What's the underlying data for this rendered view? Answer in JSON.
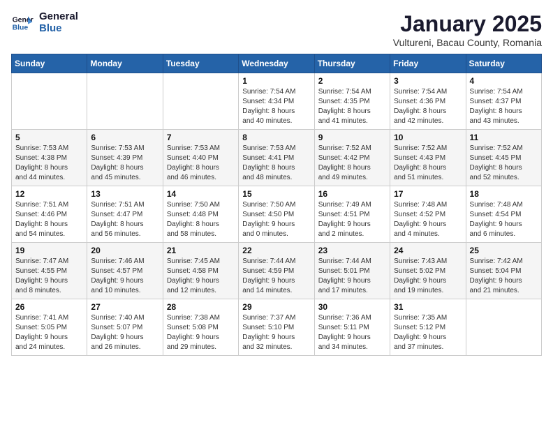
{
  "logo": {
    "line1": "General",
    "line2": "Blue"
  },
  "title": "January 2025",
  "subtitle": "Vultureni, Bacau County, Romania",
  "headers": [
    "Sunday",
    "Monday",
    "Tuesday",
    "Wednesday",
    "Thursday",
    "Friday",
    "Saturday"
  ],
  "weeks": [
    [
      {
        "day": "",
        "info": ""
      },
      {
        "day": "",
        "info": ""
      },
      {
        "day": "",
        "info": ""
      },
      {
        "day": "1",
        "info": "Sunrise: 7:54 AM\nSunset: 4:34 PM\nDaylight: 8 hours\nand 40 minutes."
      },
      {
        "day": "2",
        "info": "Sunrise: 7:54 AM\nSunset: 4:35 PM\nDaylight: 8 hours\nand 41 minutes."
      },
      {
        "day": "3",
        "info": "Sunrise: 7:54 AM\nSunset: 4:36 PM\nDaylight: 8 hours\nand 42 minutes."
      },
      {
        "day": "4",
        "info": "Sunrise: 7:54 AM\nSunset: 4:37 PM\nDaylight: 8 hours\nand 43 minutes."
      }
    ],
    [
      {
        "day": "5",
        "info": "Sunrise: 7:53 AM\nSunset: 4:38 PM\nDaylight: 8 hours\nand 44 minutes."
      },
      {
        "day": "6",
        "info": "Sunrise: 7:53 AM\nSunset: 4:39 PM\nDaylight: 8 hours\nand 45 minutes."
      },
      {
        "day": "7",
        "info": "Sunrise: 7:53 AM\nSunset: 4:40 PM\nDaylight: 8 hours\nand 46 minutes."
      },
      {
        "day": "8",
        "info": "Sunrise: 7:53 AM\nSunset: 4:41 PM\nDaylight: 8 hours\nand 48 minutes."
      },
      {
        "day": "9",
        "info": "Sunrise: 7:52 AM\nSunset: 4:42 PM\nDaylight: 8 hours\nand 49 minutes."
      },
      {
        "day": "10",
        "info": "Sunrise: 7:52 AM\nSunset: 4:43 PM\nDaylight: 8 hours\nand 51 minutes."
      },
      {
        "day": "11",
        "info": "Sunrise: 7:52 AM\nSunset: 4:45 PM\nDaylight: 8 hours\nand 52 minutes."
      }
    ],
    [
      {
        "day": "12",
        "info": "Sunrise: 7:51 AM\nSunset: 4:46 PM\nDaylight: 8 hours\nand 54 minutes."
      },
      {
        "day": "13",
        "info": "Sunrise: 7:51 AM\nSunset: 4:47 PM\nDaylight: 8 hours\nand 56 minutes."
      },
      {
        "day": "14",
        "info": "Sunrise: 7:50 AM\nSunset: 4:48 PM\nDaylight: 8 hours\nand 58 minutes."
      },
      {
        "day": "15",
        "info": "Sunrise: 7:50 AM\nSunset: 4:50 PM\nDaylight: 9 hours\nand 0 minutes."
      },
      {
        "day": "16",
        "info": "Sunrise: 7:49 AM\nSunset: 4:51 PM\nDaylight: 9 hours\nand 2 minutes."
      },
      {
        "day": "17",
        "info": "Sunrise: 7:48 AM\nSunset: 4:52 PM\nDaylight: 9 hours\nand 4 minutes."
      },
      {
        "day": "18",
        "info": "Sunrise: 7:48 AM\nSunset: 4:54 PM\nDaylight: 9 hours\nand 6 minutes."
      }
    ],
    [
      {
        "day": "19",
        "info": "Sunrise: 7:47 AM\nSunset: 4:55 PM\nDaylight: 9 hours\nand 8 minutes."
      },
      {
        "day": "20",
        "info": "Sunrise: 7:46 AM\nSunset: 4:57 PM\nDaylight: 9 hours\nand 10 minutes."
      },
      {
        "day": "21",
        "info": "Sunrise: 7:45 AM\nSunset: 4:58 PM\nDaylight: 9 hours\nand 12 minutes."
      },
      {
        "day": "22",
        "info": "Sunrise: 7:44 AM\nSunset: 4:59 PM\nDaylight: 9 hours\nand 14 minutes."
      },
      {
        "day": "23",
        "info": "Sunrise: 7:44 AM\nSunset: 5:01 PM\nDaylight: 9 hours\nand 17 minutes."
      },
      {
        "day": "24",
        "info": "Sunrise: 7:43 AM\nSunset: 5:02 PM\nDaylight: 9 hours\nand 19 minutes."
      },
      {
        "day": "25",
        "info": "Sunrise: 7:42 AM\nSunset: 5:04 PM\nDaylight: 9 hours\nand 21 minutes."
      }
    ],
    [
      {
        "day": "26",
        "info": "Sunrise: 7:41 AM\nSunset: 5:05 PM\nDaylight: 9 hours\nand 24 minutes."
      },
      {
        "day": "27",
        "info": "Sunrise: 7:40 AM\nSunset: 5:07 PM\nDaylight: 9 hours\nand 26 minutes."
      },
      {
        "day": "28",
        "info": "Sunrise: 7:38 AM\nSunset: 5:08 PM\nDaylight: 9 hours\nand 29 minutes."
      },
      {
        "day": "29",
        "info": "Sunrise: 7:37 AM\nSunset: 5:10 PM\nDaylight: 9 hours\nand 32 minutes."
      },
      {
        "day": "30",
        "info": "Sunrise: 7:36 AM\nSunset: 5:11 PM\nDaylight: 9 hours\nand 34 minutes."
      },
      {
        "day": "31",
        "info": "Sunrise: 7:35 AM\nSunset: 5:12 PM\nDaylight: 9 hours\nand 37 minutes."
      },
      {
        "day": "",
        "info": ""
      }
    ]
  ]
}
